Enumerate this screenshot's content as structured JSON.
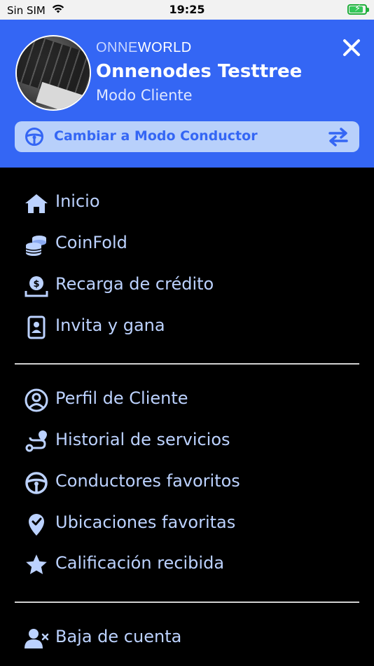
{
  "status_bar": {
    "carrier": "Sin SIM",
    "time": "19:25",
    "battery_level": 0.8
  },
  "header": {
    "brand_part1": "ONNE",
    "brand_part2": "WORLD",
    "user_name": "Onnenodes Testtree",
    "mode": "Modo Cliente",
    "switch_label": "Cambiar a Modo Conductor",
    "background_color": "#3466f4"
  },
  "menu": {
    "section1": [
      {
        "label": "Inicio",
        "icon": "home-icon"
      },
      {
        "label": "CoinFold",
        "icon": "coins-icon"
      },
      {
        "label": "Recarga de crédito",
        "icon": "money-recharge-icon"
      },
      {
        "label": "Invita y gana",
        "icon": "id-badge-icon"
      }
    ],
    "section2": [
      {
        "label": "Perfil de Cliente",
        "icon": "user-circle-icon"
      },
      {
        "label": "Historial de servicios",
        "icon": "route-icon"
      },
      {
        "label": "Conductores favoritos",
        "icon": "steering-wheel-icon"
      },
      {
        "label": "Ubicaciones favoritas",
        "icon": "location-check-icon"
      },
      {
        "label": "Calificación recibida",
        "icon": "star-icon"
      }
    ],
    "section3": [
      {
        "label": "Baja de cuenta",
        "icon": "user-remove-icon"
      }
    ]
  },
  "colors": {
    "accent": "#3466f4",
    "menu_text": "#bcd2ff",
    "switch_bg": "#b8d0fb"
  }
}
